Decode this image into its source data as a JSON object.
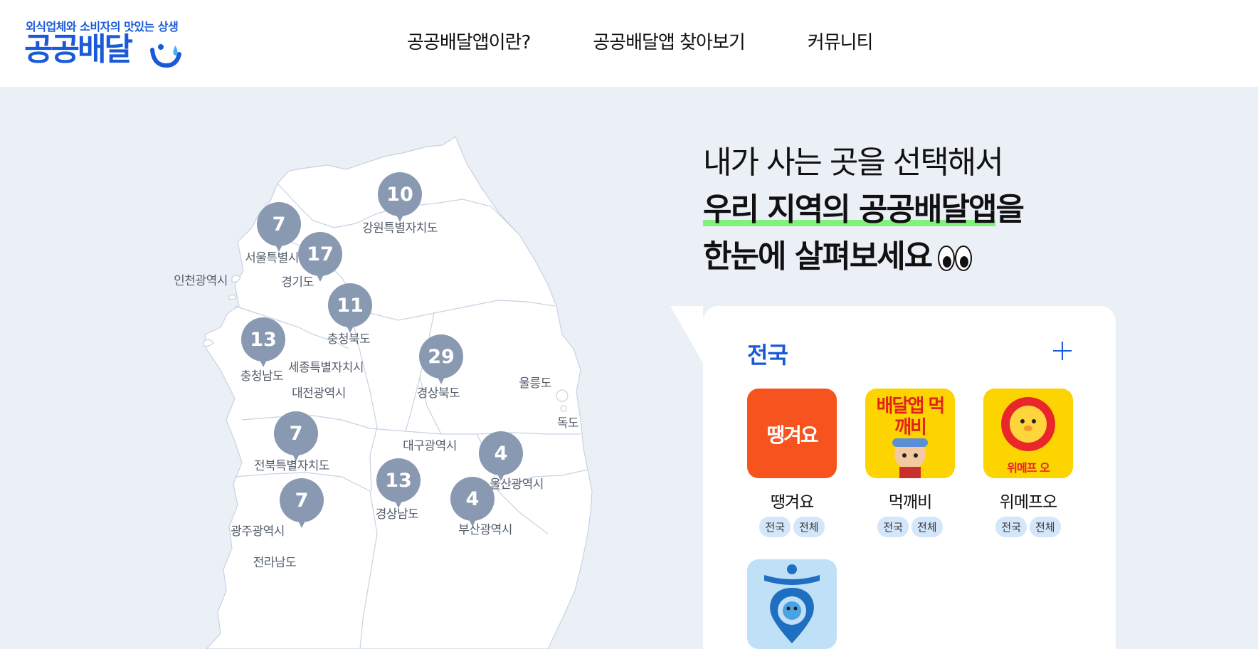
{
  "header": {
    "tagline": "외식업체와 소비자의 맛있는 상생",
    "logo": "공공배달",
    "nav": [
      "공공배달앱이란?",
      "공공배달앱 찾아보기",
      "커뮤니티"
    ]
  },
  "map": {
    "regions": [
      {
        "label": "강원특별자치도",
        "count": "10"
      },
      {
        "label": "서울특별시",
        "count": "7"
      },
      {
        "label": "경기도",
        "count": "17"
      },
      {
        "label": "인천광역시",
        "count": ""
      },
      {
        "label": "충청북도",
        "count": "11"
      },
      {
        "label": "충청남도",
        "count": "13"
      },
      {
        "label": "세종특별자치시",
        "count": ""
      },
      {
        "label": "대전광역시",
        "count": ""
      },
      {
        "label": "경상북도",
        "count": "29"
      },
      {
        "label": "울릉도",
        "count": ""
      },
      {
        "label": "독도",
        "count": ""
      },
      {
        "label": "대구광역시",
        "count": ""
      },
      {
        "label": "전북특별자치도",
        "count": "7"
      },
      {
        "label": "울산광역시",
        "count": "4"
      },
      {
        "label": "경상남도",
        "count": "13"
      },
      {
        "label": "부산광역시",
        "count": "4"
      },
      {
        "label": "광주광역시",
        "count": "7"
      },
      {
        "label": "전라남도",
        "count": ""
      }
    ]
  },
  "headline": {
    "line1": "내가 사는 곳을 선택해서",
    "line2_highlight": "우리 지역의 공공배달앱",
    "line2_rest": "을",
    "line3": "한눈에 살펴보세요"
  },
  "panel": {
    "title": "전국",
    "apps": [
      {
        "name": "땡겨요",
        "icon_text": "땡겨요",
        "tags": [
          "전국",
          "전체"
        ],
        "bg": "#f7531e"
      },
      {
        "name": "먹깨비",
        "icon_text": "배달앱 먹깨비",
        "tags": [
          "전국",
          "전체"
        ],
        "bg": "#fdd400"
      },
      {
        "name": "위메프오",
        "icon_text": "위메프 오",
        "tags": [
          "전국",
          "전체"
        ],
        "bg": "#fcd400"
      },
      {
        "name": "",
        "icon_text": "",
        "tags": [],
        "bg": "#bfe0f6"
      }
    ]
  },
  "colors": {
    "brand": "#1a5ad8",
    "pin": "#8a99b2",
    "highlight": "#82f07c",
    "background": "#ebf0f7"
  }
}
